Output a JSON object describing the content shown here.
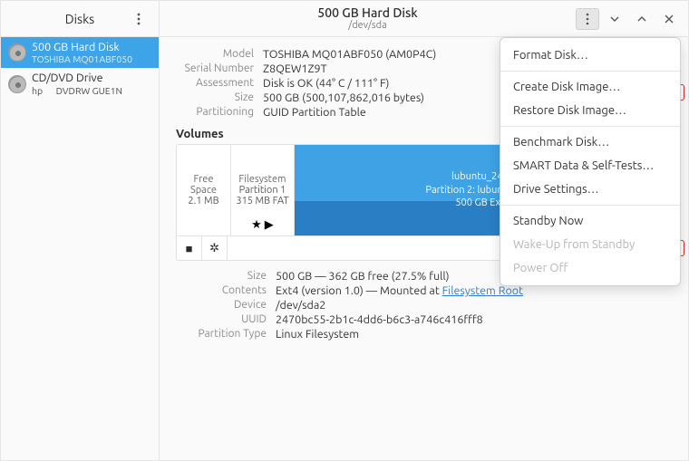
{
  "sidebar": {
    "title": "Disks",
    "items": [
      {
        "label": "500 GB Hard Disk",
        "sub": "TOSHIBA MQ01ABF050"
      },
      {
        "label": "CD/DVD Drive",
        "sub": "hp      DVDRW GUE1N"
      }
    ]
  },
  "titlebar": {
    "title": "500 GB Hard Disk",
    "subtitle": "/dev/sda"
  },
  "details": {
    "model_k": "Model",
    "model_v": "TOSHIBA MQ01ABF050 (AM0P4C)",
    "serial_k": "Serial Number",
    "serial_v": "Z8QEW1Z9T",
    "assess_k": "Assessment",
    "assess_v": "Disk is OK (44° C / 111° F)",
    "size_k": "Size",
    "size_v": "500 GB (500,107,862,016 bytes)",
    "part_k": "Partitioning",
    "part_v": "GUID Partition Table"
  },
  "volumes_title": "Volumes",
  "volumes": {
    "free": {
      "l1": "Free Space",
      "l2": "2.1 MB"
    },
    "fs": {
      "l1": "Filesystem",
      "l2": "Partition 1",
      "l3": "315 MB FAT"
    },
    "main": {
      "l1": "lubuntu_2404",
      "l2": "Partition 2: lubuntu_2404",
      "l3": "500 GB Ext4"
    },
    "stars": "★ ▶"
  },
  "tool_icons": {
    "stop": "■",
    "gear": "✲"
  },
  "selected": {
    "size_k": "Size",
    "size_v": "500 GB — 362 GB free (27.5% full)",
    "contents_k": "Contents",
    "contents_v_pre": "Ext4 (version 1.0) — Mounted at ",
    "contents_link": "Filesystem Root",
    "device_k": "Device",
    "device_v": "/dev/sda2",
    "uuid_k": "UUID",
    "uuid_v": "2470bc55-2b1c-4dd6-b6c3-a746c416fff8",
    "ptype_k": "Partition Type",
    "ptype_v": "Linux Filesystem"
  },
  "menu": {
    "format": "Format Disk…",
    "create_image": "Create Disk Image…",
    "restore_image": "Restore Disk Image…",
    "benchmark": "Benchmark Disk…",
    "smart": "SMART Data & Self-Tests…",
    "settings": "Drive Settings…",
    "standby": "Standby Now",
    "wakeup": "Wake-Up from Standby",
    "poweroff": "Power Off"
  }
}
